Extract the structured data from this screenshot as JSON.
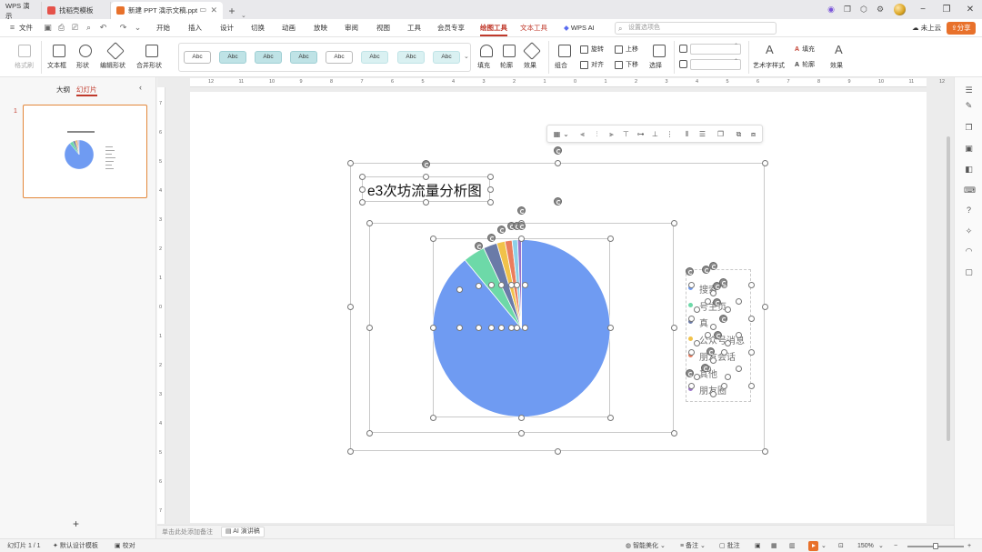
{
  "titlebar": {
    "tabs": [
      {
        "label": "WPS 演示",
        "type": "app"
      },
      {
        "label": "找稻壳模板",
        "type": "template",
        "color": "#e5524a"
      },
      {
        "label": "新建 PPT 演示文稿.ppt",
        "type": "doc",
        "color": "#e8712b",
        "active": true
      }
    ],
    "new_tab": "+",
    "tab_dropdown": "⌄"
  },
  "menubar": {
    "file": "文件",
    "items": [
      "开始",
      "插入",
      "设计",
      "切换",
      "动画",
      "放映",
      "审阅",
      "视图",
      "工具",
      "会员专享",
      "绘图工具",
      "文本工具",
      "WPS AI"
    ],
    "active_item": "绘图工具",
    "search_placeholder": "设置选项色",
    "cloud": "未上云",
    "share": "分享"
  },
  "ribbon": {
    "format_painter": "格式刷",
    "textbox": "文本框",
    "shape": "形状",
    "edit_shape": "编辑形状",
    "merge_shape": "合并形状",
    "style_buttons": [
      "Abc",
      "Abc",
      "Abc",
      "Abc",
      "Abc",
      "Abc",
      "Abc",
      "Abc"
    ],
    "fill": "填充",
    "outline": "轮廓",
    "effect": "效果",
    "group": "组合",
    "align": "对齐",
    "rotate": "旋转",
    "bring_up": "上移",
    "send_down": "下移",
    "select": "选择",
    "art_text_style": "艺术字样式",
    "text_fill": "填充",
    "text_outline": "轮廓",
    "text_effect": "效果"
  },
  "leftpanel": {
    "tab_outline": "大纲",
    "tab_slides": "幻灯片",
    "slide_number": "1",
    "add": "+"
  },
  "ruler": {
    "h_ticks": [
      "12",
      "11",
      "10",
      "9",
      "8",
      "7",
      "6",
      "5",
      "4",
      "3",
      "2",
      "1",
      "0",
      "1",
      "2",
      "3",
      "4",
      "5",
      "6",
      "7",
      "8",
      "9",
      "10",
      "11",
      "12"
    ],
    "v_ticks": [
      "7",
      "6",
      "5",
      "4",
      "3",
      "2",
      "1",
      "0",
      "1",
      "2",
      "3",
      "4",
      "5",
      "6",
      "7"
    ]
  },
  "slide": {
    "title": "e3次坊流量分析图",
    "legend": [
      "搜索",
      "号主页",
      "真",
      "公众号消息",
      "朋友会话",
      "其他",
      "朋友圈"
    ],
    "legend_colors": [
      "#6f9bf2",
      "#6dd9a8",
      "#6a7ba8",
      "#f1c24a",
      "#ea7d5e",
      "#8cd0e8",
      "#9b73c9"
    ]
  },
  "chart_data": {
    "type": "pie",
    "title": "e3次坊流量分析图",
    "categories": [
      "搜索",
      "号主页",
      "真",
      "公众号消息",
      "朋友会话",
      "其他",
      "朋友圈"
    ],
    "values": [
      89,
      4,
      2.5,
      1.5,
      1.3,
      1.0,
      0.7
    ],
    "colors": [
      "#6f9bf2",
      "#6dd9a8",
      "#6a7ba8",
      "#f1c24a",
      "#ea7d5e",
      "#8cd0e8",
      "#9b73c9"
    ],
    "legend": "right"
  },
  "notes": {
    "placeholder": "单击此处添加备注",
    "ai_button": "AI 演讲稿"
  },
  "statusbar": {
    "slide_info": "幻灯片 1 / 1",
    "design_template": "默认设计模板",
    "proofread": "校对",
    "beautify": "智能美化",
    "notes": "备注",
    "comments": "批注",
    "zoom": "150%",
    "zoom_minus": "−",
    "zoom_plus": "+"
  }
}
